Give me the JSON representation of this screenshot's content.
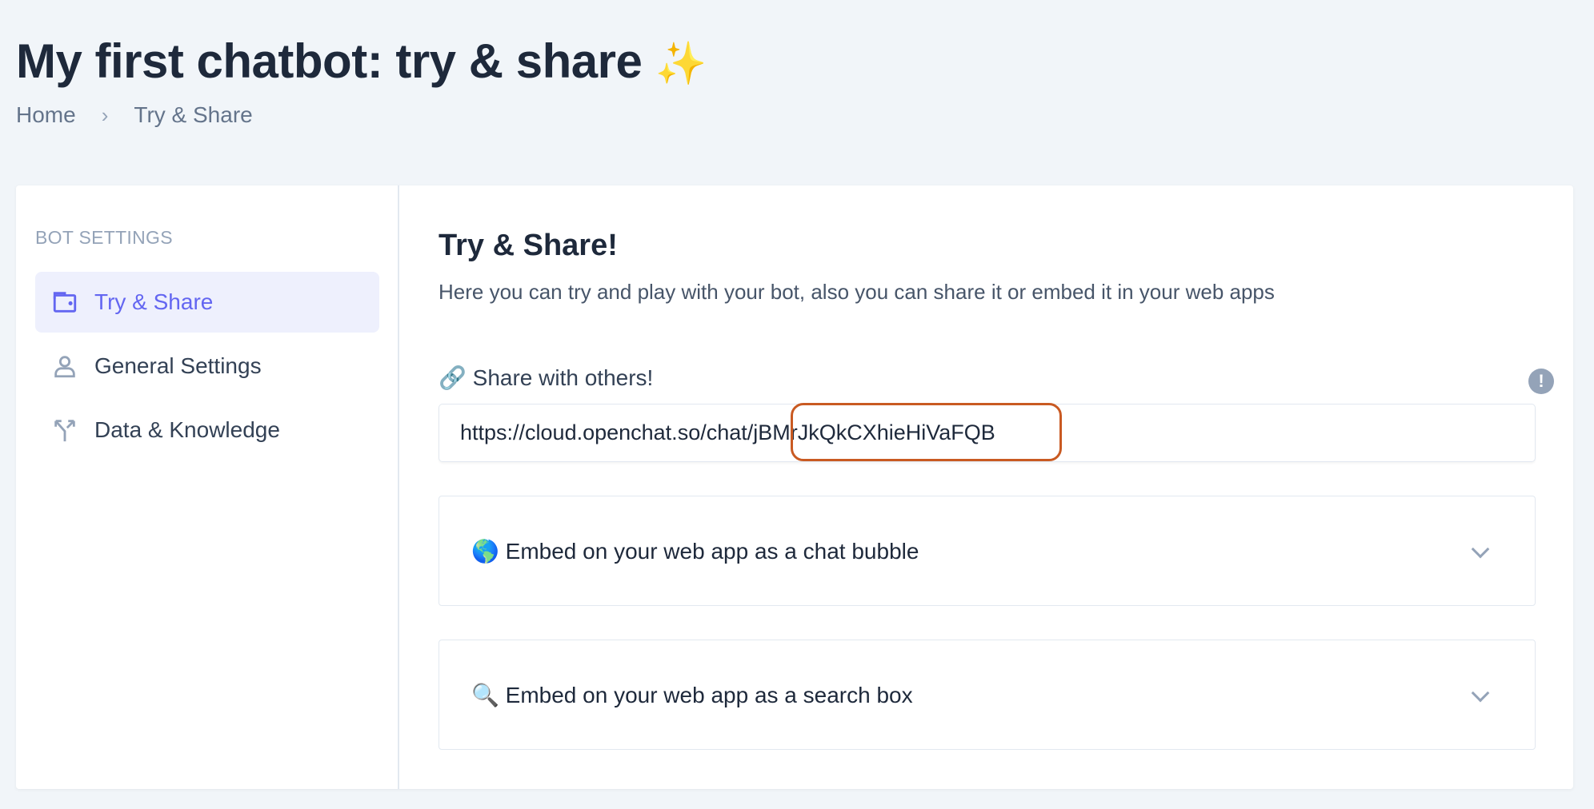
{
  "page": {
    "title": "My first chatbot: try & share",
    "title_emoji": "✨"
  },
  "breadcrumb": {
    "items": [
      "Home",
      "Try & Share"
    ],
    "separator": "›"
  },
  "sidebar": {
    "header": "BOT SETTINGS",
    "items": [
      {
        "label": "Try & Share",
        "icon": "wallet-icon",
        "active": true
      },
      {
        "label": "General Settings",
        "icon": "user-icon",
        "active": false
      },
      {
        "label": "Data & Knowledge",
        "icon": "split-arrows-icon",
        "active": false
      }
    ]
  },
  "main": {
    "heading": "Try & Share!",
    "subtitle": "Here you can try and play with your bot, also you can share it or embed it in your web apps",
    "share": {
      "label": "🔗 Share with others!",
      "info_icon": "!",
      "url_base": "https://cloud.openchat.so/chat/",
      "url_id": "jBMrJkQkCXhieHiVaFQB",
      "highlight_color": "#c95a22"
    },
    "accordions": [
      {
        "label": "🌎 Embed on your web app as a chat bubble"
      },
      {
        "label": "🔍 Embed on your web app as a search box"
      }
    ]
  },
  "colors": {
    "accent": "#6366f1",
    "background": "#f1f5f9"
  }
}
